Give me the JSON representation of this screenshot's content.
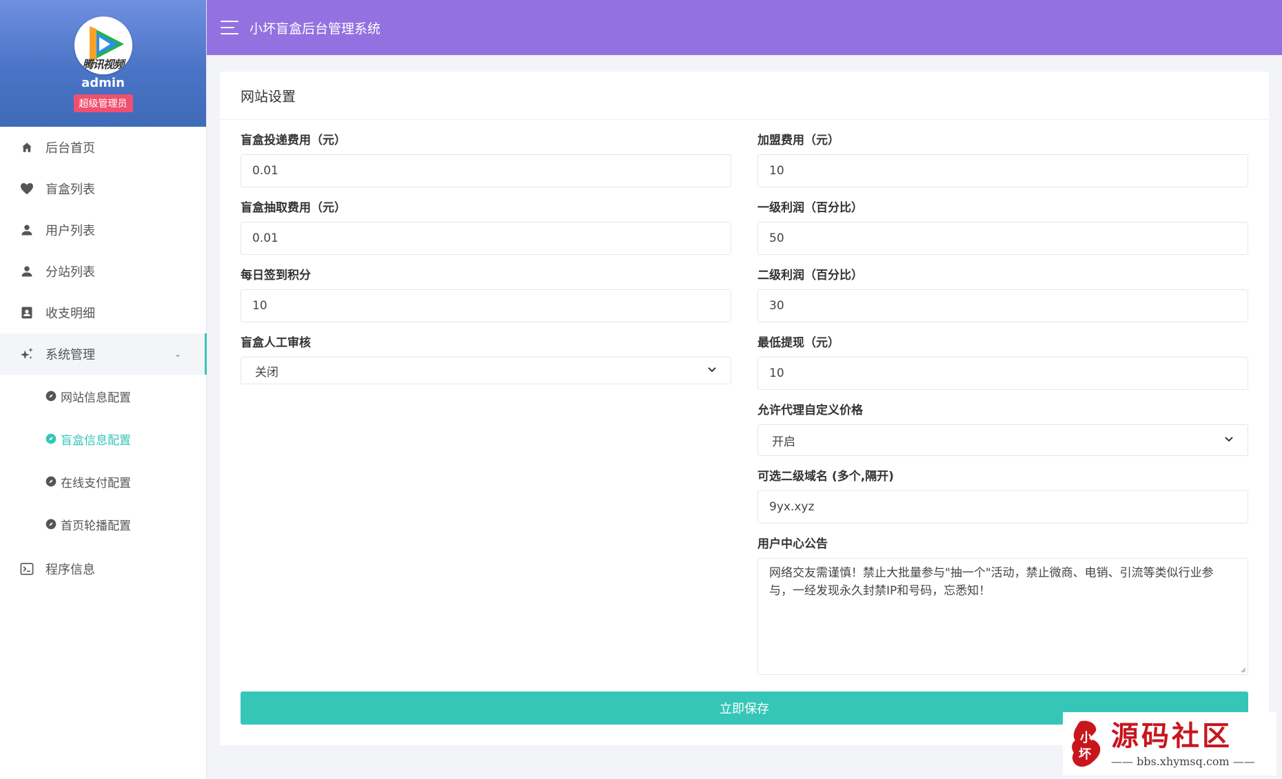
{
  "profile": {
    "avatar_logo_text": "腾讯视频",
    "username": "admin",
    "role": "超级管理员"
  },
  "topbar": {
    "title": "小坏盲盒后台管理系统"
  },
  "menu": {
    "items": [
      {
        "label": "后台首页",
        "icon": "home-icon"
      },
      {
        "label": "盲盒列表",
        "icon": "heart-icon"
      },
      {
        "label": "用户列表",
        "icon": "user-icon"
      },
      {
        "label": "分站列表",
        "icon": "user-icon"
      },
      {
        "label": "收支明细",
        "icon": "contact-book-icon"
      },
      {
        "label": "系统管理",
        "icon": "sparkles-icon",
        "expanded": true
      },
      {
        "label": "程序信息",
        "icon": "terminal-icon"
      }
    ],
    "submenu": [
      {
        "label": "网站信息配置",
        "active": false
      },
      {
        "label": "盲盒信息配置",
        "active": true
      },
      {
        "label": "在线支付配置",
        "active": false
      },
      {
        "label": "首页轮播配置",
        "active": false
      }
    ]
  },
  "card": {
    "title": "网站设置"
  },
  "form": {
    "left": [
      {
        "label": "盲盒投递费用（元）",
        "value": "0.01"
      },
      {
        "label": "盲盒抽取费用（元）",
        "value": "0.01"
      },
      {
        "label": "每日签到积分",
        "value": "10"
      },
      {
        "label": "盲盒人工审核",
        "value": "关闭"
      }
    ],
    "right": [
      {
        "label": "加盟费用（元）",
        "value": "10"
      },
      {
        "label": "一级利润（百分比）",
        "value": "50"
      },
      {
        "label": "二级利润（百分比）",
        "value": "30"
      },
      {
        "label": "最低提现（元）",
        "value": "10"
      },
      {
        "label": "允许代理自定义价格",
        "value": "开启"
      },
      {
        "label": "可选二级域名 (多个,隔开)",
        "value": "9yx.xyz"
      },
      {
        "label": "用户中心公告",
        "value": "网络交友需谨慎！禁止大批量参与\"抽一个\"活动，禁止微商、电销、引流等类似行业参与，一经发现永久封禁IP和号码，忘悉知！"
      }
    ],
    "save_label": "立即保存"
  },
  "watermark": {
    "seal_text": "小坏",
    "title": "源码社区",
    "url": "—— bbs.xhymsq.com ——"
  },
  "colors": {
    "topbar": "#9471e0",
    "accent": "#36c6b8",
    "badge": "#f0506e",
    "profile_gradient_top": "#6f8fe0",
    "profile_gradient_bottom": "#3e6bb8"
  }
}
